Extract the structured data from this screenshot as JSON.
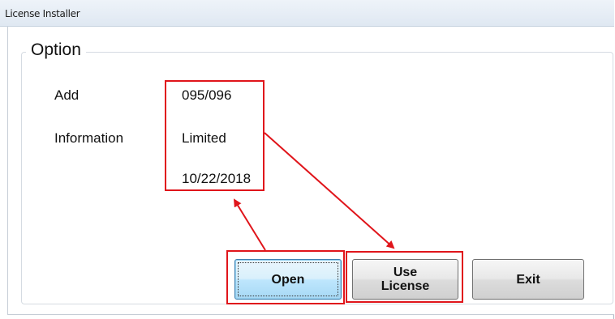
{
  "window": {
    "title": "License Installer"
  },
  "option_group": {
    "legend": "Option",
    "labels": {
      "add": "Add",
      "information": "Information"
    },
    "values": {
      "add_value": "095/096",
      "info_value": "Limited",
      "date_value": "10/22/2018"
    }
  },
  "buttons": {
    "open": "Open",
    "use_license_line1": "Use",
    "use_license_line2": "License",
    "exit": "Exit"
  },
  "annotation": {
    "color": "#e0151b"
  }
}
